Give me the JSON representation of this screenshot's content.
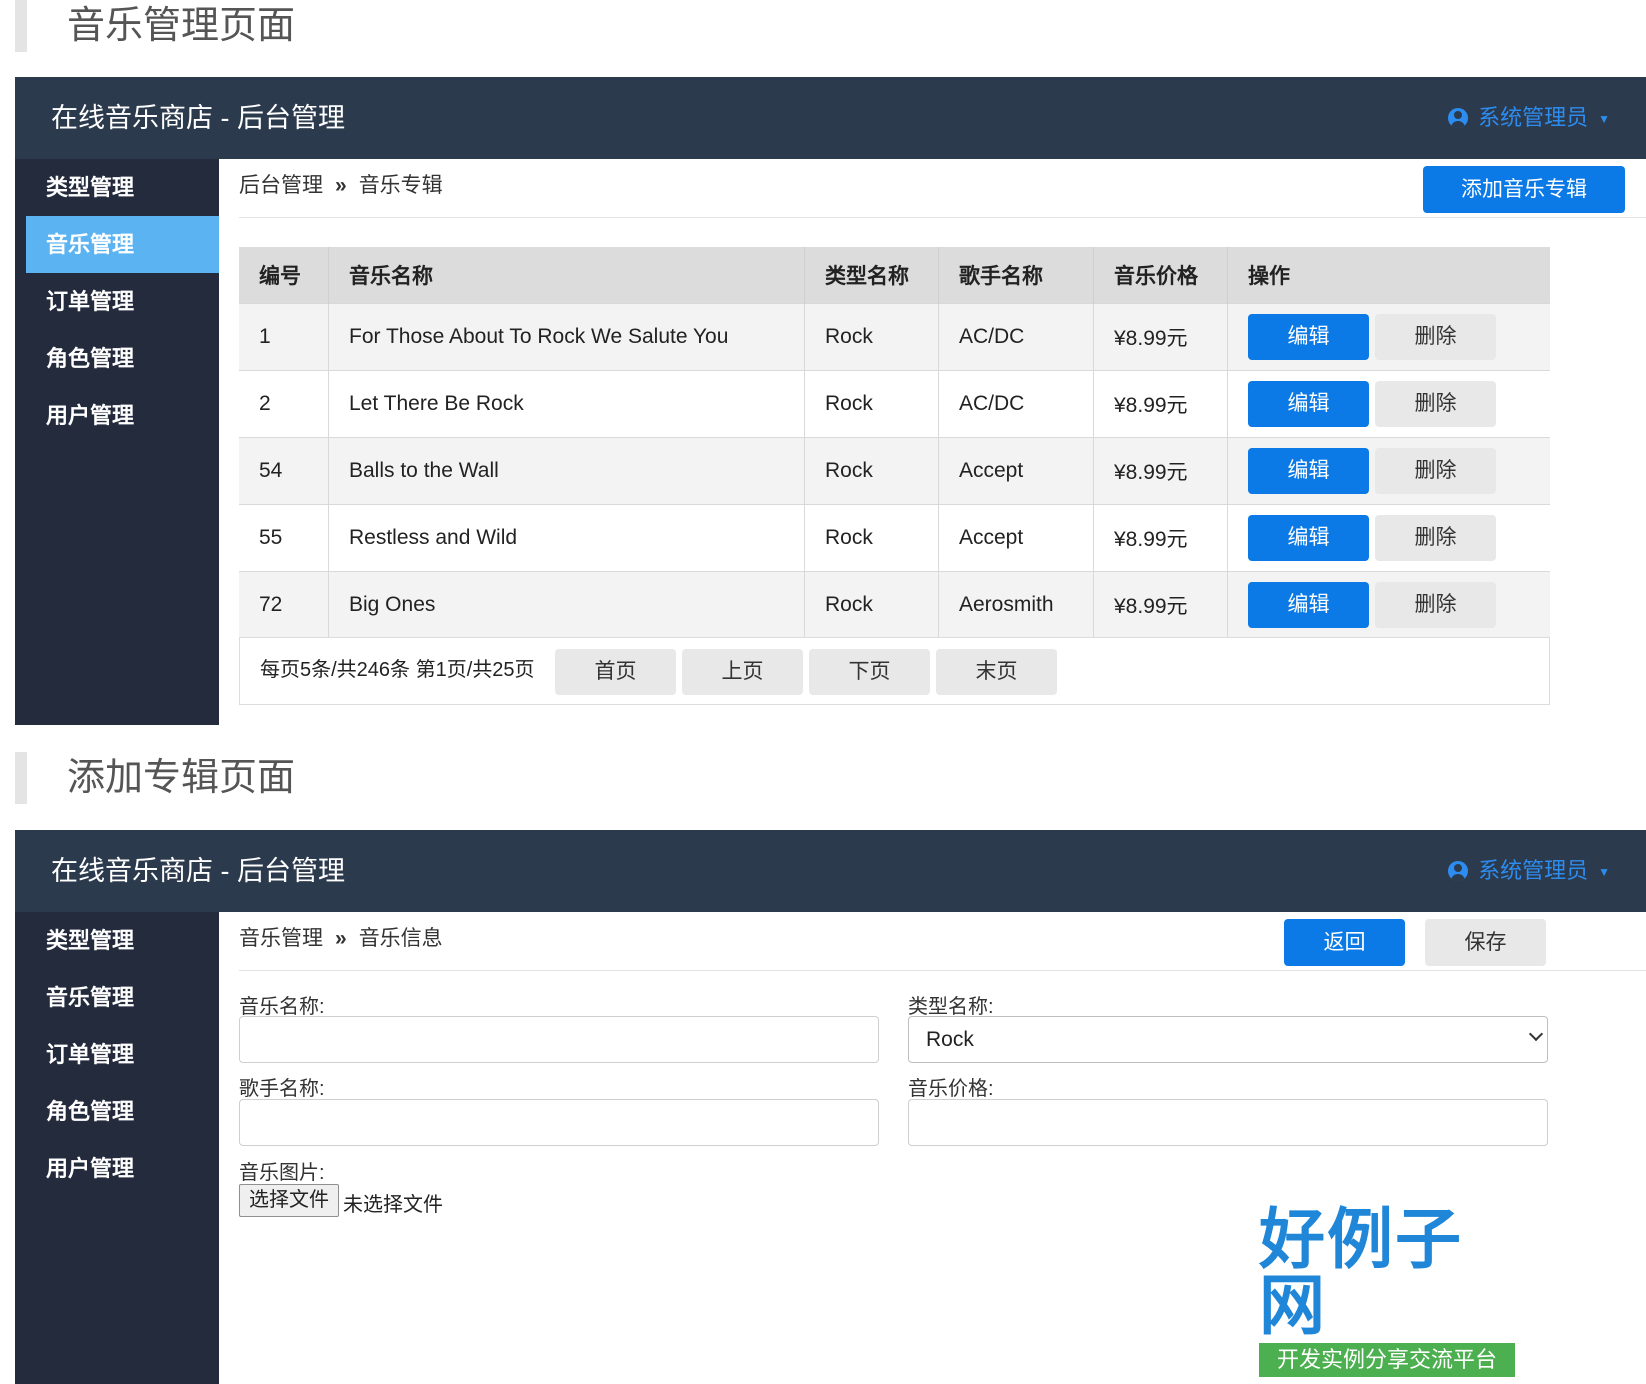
{
  "sections": {
    "list_title": "音乐管理页面",
    "add_title": "添加专辑页面"
  },
  "header": {
    "brand": "在线音乐商店 - 后台管理",
    "user_name": "系统管理员"
  },
  "sidebar": {
    "items": [
      {
        "label": "类型管理"
      },
      {
        "label": "音乐管理"
      },
      {
        "label": "订单管理"
      },
      {
        "label": "角色管理"
      },
      {
        "label": "用户管理"
      }
    ]
  },
  "list_page": {
    "breadcrumb": {
      "root": "后台管理",
      "separator": "»",
      "current": "音乐专辑"
    },
    "add_button": "添加音乐专辑",
    "columns": [
      "编号",
      "音乐名称",
      "类型名称",
      "歌手名称",
      "音乐价格",
      "操作"
    ],
    "rows": [
      {
        "id": "1",
        "name": "For Those About To Rock We Salute You",
        "genre": "Rock",
        "artist": "AC/DC",
        "price": "¥8.99元"
      },
      {
        "id": "2",
        "name": "Let There Be Rock",
        "genre": "Rock",
        "artist": "AC/DC",
        "price": "¥8.99元"
      },
      {
        "id": "54",
        "name": "Balls to the Wall",
        "genre": "Rock",
        "artist": "Accept",
        "price": "¥8.99元"
      },
      {
        "id": "55",
        "name": "Restless and Wild",
        "genre": "Rock",
        "artist": "Accept",
        "price": "¥8.99元"
      },
      {
        "id": "72",
        "name": "Big Ones",
        "genre": "Rock",
        "artist": "Aerosmith",
        "price": "¥8.99元"
      }
    ],
    "edit_label": "编辑",
    "delete_label": "删除",
    "pager": {
      "info": "每页5条/共246条 第1页/共25页",
      "first": "首页",
      "prev": "上页",
      "next": "下页",
      "last": "末页"
    }
  },
  "add_page": {
    "breadcrumb": {
      "root": "音乐管理",
      "separator": "»",
      "current": "音乐信息"
    },
    "back_button": "返回",
    "save_button": "保存",
    "fields": {
      "music_name_label": "音乐名称:",
      "genre_label": "类型名称:",
      "genre_value": "Rock",
      "artist_label": "歌手名称:",
      "price_label": "音乐价格:",
      "image_label": "音乐图片:",
      "file_button": "选择文件",
      "file_status": "未选择文件"
    }
  },
  "watermark": {
    "logo": "好例子网",
    "tagline": "开发实例分享交流平台"
  },
  "colors": {
    "header_bg": "#2b3a4d",
    "sidebar_bg": "#232b3d",
    "active_nav": "#5cb3f2",
    "primary": "#0b7ae6",
    "user_link": "#2d8cf0"
  }
}
